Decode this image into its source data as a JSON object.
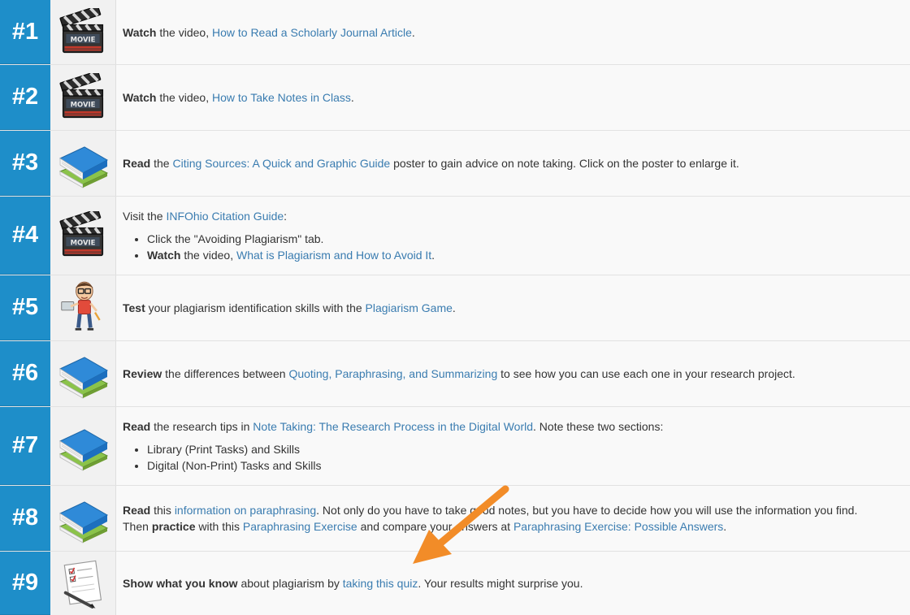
{
  "rows": [
    {
      "number": "#1",
      "icon": "movie-clapper-icon",
      "bold": "Watch",
      "t1": " the video, ",
      "link": "How to Read a Scholarly Journal Article",
      "t2": "."
    },
    {
      "number": "#2",
      "icon": "movie-clapper-icon",
      "bold": "Watch",
      "t1": " the video, ",
      "link": "How to Take Notes in Class",
      "t2": "."
    },
    {
      "number": "#3",
      "icon": "book-stack-icon",
      "bold": "Read",
      "t1": " the ",
      "link": "Citing Sources: A Quick and Graphic Guide",
      "t2": " poster to gain advice on note taking. Click on the poster to enlarge it."
    },
    {
      "number": "#4",
      "icon": "movie-clapper-icon",
      "t1": "Visit the ",
      "link": "INFOhio Citation Guide",
      "t2": ":",
      "bullet1": "Click the \"Avoiding Plagiarism\" tab.",
      "bullet2_bold": "Watch",
      "bullet2_t1": " the video, ",
      "bullet2_link": "What is Plagiarism and How to Avoid It",
      "bullet2_t2": "."
    },
    {
      "number": "#5",
      "icon": "student-cartoon-icon",
      "bold": "Test",
      "t1": " your plagiarism identification skills with the ",
      "link": "Plagiarism Game",
      "t2": "."
    },
    {
      "number": "#6",
      "icon": "book-stack-icon",
      "bold": "Review",
      "t1": " the differences between ",
      "link": "Quoting, Paraphrasing, and Summarizing",
      "t2": " to see how you can use each one in your research project."
    },
    {
      "number": "#7",
      "icon": "book-stack-icon",
      "bold": "Read",
      "t1": " the research tips in ",
      "link": "Note Taking: The Research Process in the Digital World",
      "t2": ". Note these two sections:",
      "bullet1": "Library (Print Tasks) and Skills",
      "bullet2": "Digital (Non-Print) Tasks and Skills"
    },
    {
      "number": "#8",
      "icon": "book-stack-icon",
      "bold": "Read",
      "t1": " this ",
      "link": "information on paraphrasing",
      "t2": ". Not only do you have to take good notes, but you have to decide how you will use the information you find.",
      "l2_t1": "Then ",
      "l2_bold": "practice",
      "l2_t2": " with this ",
      "l2_link1": "Paraphrasing Exercise",
      "l2_t3": " and compare your answers at ",
      "l2_link2": "Paraphrasing Exercise: Possible Answers",
      "l2_t4": "."
    },
    {
      "number": "#9",
      "icon": "checklist-quiz-icon",
      "bold": "Show what you know",
      "t1": " about plagiarism by ",
      "link": "taking this quiz",
      "t2": ". Your results might surprise you."
    }
  ],
  "colors": {
    "number_bg": "#1e8ec9",
    "link": "#3a7cb0",
    "arrow": "#f28c28"
  }
}
